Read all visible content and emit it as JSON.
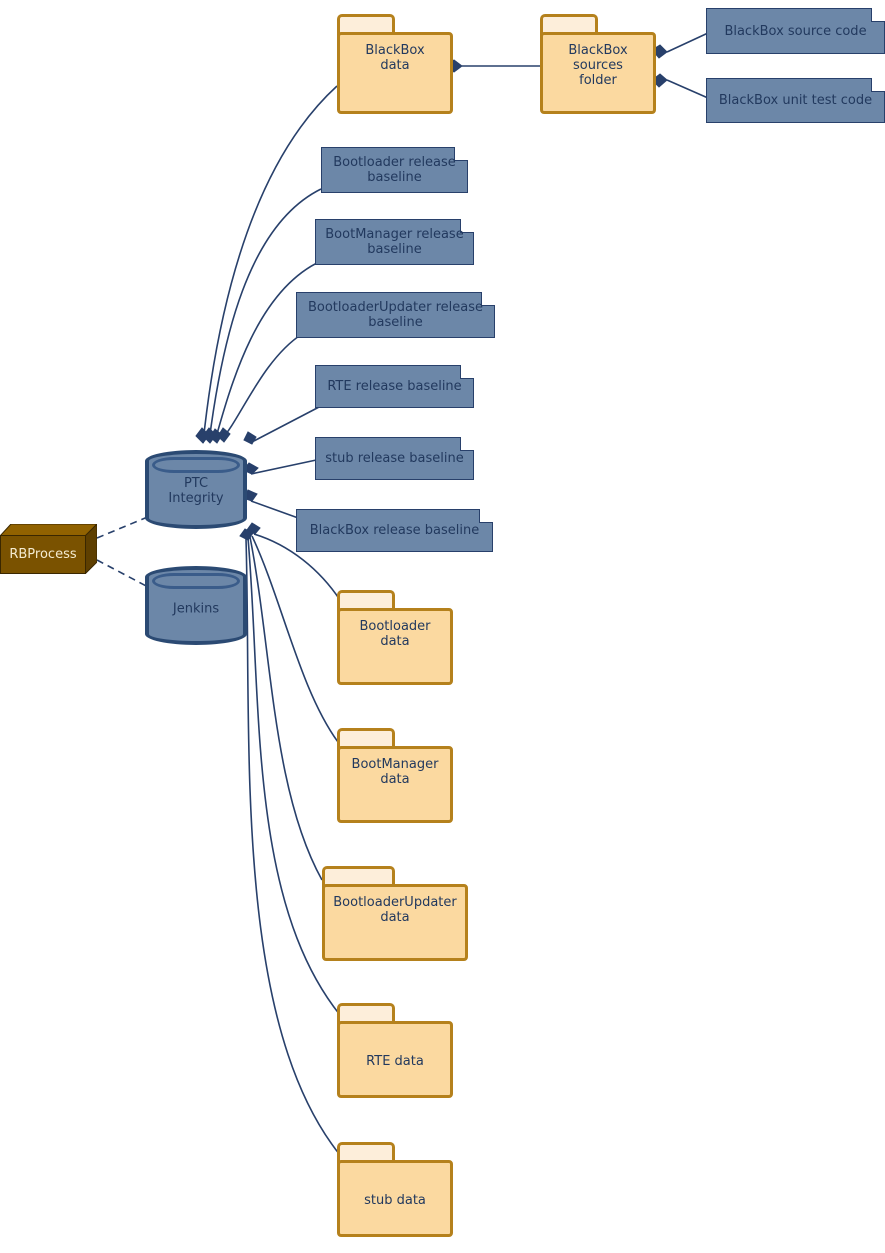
{
  "diagram": {
    "type": "uml-deployment-diagram",
    "background": "#ffffff",
    "palette": {
      "artifact_fill": "#6C87A8",
      "artifact_border": "#28406B",
      "folder_fill": "#FBD9A0",
      "folder_tab_fill": "#FDEEDA",
      "folder_border": "#B5811C",
      "database_fill": "#6C87A8",
      "database_border": "#2B4A73",
      "node_fill": "#7A5200",
      "node_text": "#F4EBD0",
      "edge_color": "#28406B",
      "text_color": "#22395E"
    },
    "databases": [
      {
        "id": "ptc",
        "label": "PTC\nIntegrity",
        "label_line1": "PTC",
        "label_line2": "Integrity"
      },
      {
        "id": "jenkins",
        "label": "Jenkins",
        "label_line1": "Jenkins",
        "label_line2": ""
      }
    ],
    "nodes": [
      {
        "id": "rbprocess",
        "label": "RBProcess"
      }
    ],
    "folders": [
      {
        "id": "blackbox-data",
        "label_line1": "BlackBox",
        "label_line2": "data"
      },
      {
        "id": "blackbox-sources-folder",
        "label_line1": "BlackBox",
        "label_line2": "sources",
        "label_line3": "folder"
      },
      {
        "id": "bootloader-data",
        "label_line1": "Bootloader",
        "label_line2": "data"
      },
      {
        "id": "bootmanager-data",
        "label_line1": "BootManager",
        "label_line2": "data"
      },
      {
        "id": "bootloaderupdater-data",
        "label_line1": "BootloaderUpdater",
        "label_line2": "data"
      },
      {
        "id": "rte-data",
        "label_line1": "RTE data",
        "label_line2": ""
      },
      {
        "id": "stub-data",
        "label_line1": "stub data",
        "label_line2": ""
      }
    ],
    "artifacts": [
      {
        "id": "blackbox-source-code",
        "label_line1": "BlackBox source code",
        "label_line2": ""
      },
      {
        "id": "blackbox-unit-test-code",
        "label_line1": "BlackBox unit test code",
        "label_line2": ""
      },
      {
        "id": "bootloader-release-baseline",
        "label_line1": "Bootloader release",
        "label_line2": "baseline"
      },
      {
        "id": "bootmanager-release-baseline",
        "label_line1": "BootManager release",
        "label_line2": "baseline"
      },
      {
        "id": "bootloaderupdater-release-baseline",
        "label_line1": "BootloaderUpdater release",
        "label_line2": "baseline"
      },
      {
        "id": "rte-release-baseline",
        "label_line1": "RTE release baseline",
        "label_line2": ""
      },
      {
        "id": "stub-release-baseline",
        "label_line1": "stub release baseline",
        "label_line2": ""
      },
      {
        "id": "blackbox-release-baseline",
        "label_line1": "BlackBox release baseline",
        "label_line2": ""
      }
    ],
    "edges": [
      {
        "from": "blackbox-data",
        "to": "blackbox-sources-folder",
        "kind": "composition"
      },
      {
        "from": "blackbox-sources-folder",
        "to": "blackbox-source-code",
        "kind": "composition"
      },
      {
        "from": "blackbox-sources-folder",
        "to": "blackbox-unit-test-code",
        "kind": "composition"
      },
      {
        "from": "ptc",
        "to": "blackbox-data",
        "kind": "composition"
      },
      {
        "from": "ptc",
        "to": "bootloader-release-baseline",
        "kind": "composition"
      },
      {
        "from": "ptc",
        "to": "bootmanager-release-baseline",
        "kind": "composition"
      },
      {
        "from": "ptc",
        "to": "bootloaderupdater-release-baseline",
        "kind": "composition"
      },
      {
        "from": "ptc",
        "to": "rte-release-baseline",
        "kind": "composition"
      },
      {
        "from": "ptc",
        "to": "stub-release-baseline",
        "kind": "composition"
      },
      {
        "from": "ptc",
        "to": "blackbox-release-baseline",
        "kind": "composition"
      },
      {
        "from": "ptc",
        "to": "bootloader-data",
        "kind": "composition"
      },
      {
        "from": "ptc",
        "to": "bootmanager-data",
        "kind": "composition"
      },
      {
        "from": "ptc",
        "to": "bootloaderupdater-data",
        "kind": "composition"
      },
      {
        "from": "ptc",
        "to": "rte-data",
        "kind": "composition"
      },
      {
        "from": "ptc",
        "to": "stub-data",
        "kind": "composition"
      },
      {
        "from": "rbprocess",
        "to": "ptc",
        "kind": "dependency"
      },
      {
        "from": "rbprocess",
        "to": "jenkins",
        "kind": "dependency"
      }
    ]
  }
}
